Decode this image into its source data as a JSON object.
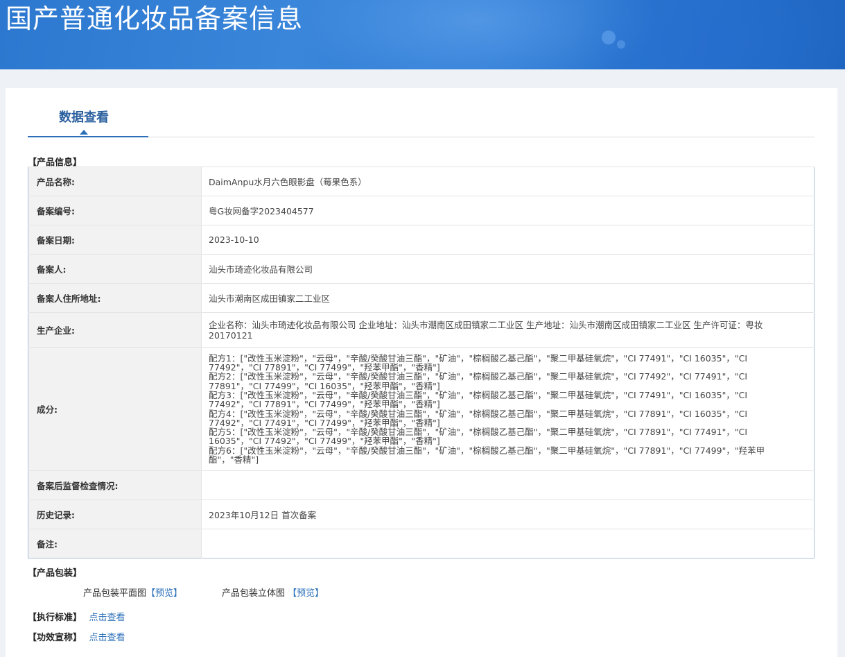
{
  "header": {
    "title": "国产普通化妆品备案信息"
  },
  "tabs": [
    {
      "label": "数据查看"
    }
  ],
  "product_info": {
    "section_title": "【产品信息】",
    "rows": [
      {
        "label": "产品名称:",
        "value": "DaimAnpu水月六色眼影盘（莓果色系）"
      },
      {
        "label": "备案编号:",
        "value": "粤G妆网备字2023404577"
      },
      {
        "label": "备案日期:",
        "value": "2023-10-10"
      },
      {
        "label": "备案人:",
        "value": "汕头市琦迹化妆品有限公司"
      },
      {
        "label": "备案人住所地址:",
        "value": "汕头市潮南区成田镇家二工业区"
      },
      {
        "label": "生产企业:",
        "value": "企业名称：汕头市琦迹化妆品有限公司 企业地址：汕头市潮南区成田镇家二工业区 生产地址：汕头市潮南区成田镇家二工业区 生产许可证：粤妆20170121"
      },
      {
        "label": "成分:",
        "formulas": [
          "配方1：[\"改性玉米淀粉\"，\"云母\"，\"辛酸/癸酸甘油三酯\"，\"矿油\"，\"棕榈酸乙基己酯\"，\"聚二甲基硅氧烷\"，\"CI 77491\"，\"CI 16035\"，\"CI 77492\"，\"CI 77891\"，\"CI 77499\"，\"羟苯甲酯\"，\"香精\"]",
          "配方2：[\"改性玉米淀粉\"，\"云母\"，\"辛酸/癸酸甘油三酯\"，\"矿油\"，\"棕榈酸乙基己酯\"，\"聚二甲基硅氧烷\"，\"CI 77492\"，\"CI 77491\"，\"CI 77891\"，\"CI 77499\"，\"CI 16035\"，\"羟苯甲酯\"，\"香精\"]",
          "配方3：[\"改性玉米淀粉\"，\"云母\"，\"辛酸/癸酸甘油三酯\"，\"矿油\"，\"棕榈酸乙基己酯\"，\"聚二甲基硅氧烷\"，\"CI 77491\"，\"CI 16035\"，\"CI 77492\"，\"CI 77891\"，\"CI 77499\"，\"羟苯甲酯\"，\"香精\"]",
          "配方4：[\"改性玉米淀粉\"，\"云母\"，\"辛酸/癸酸甘油三酯\"，\"矿油\"，\"棕榈酸乙基己酯\"，\"聚二甲基硅氧烷\"，\"CI 77891\"，\"CI 16035\"，\"CI 77492\"，\"CI 77491\"，\"CI 77499\"，\"羟苯甲酯\"，\"香精\"]",
          "配方5：[\"改性玉米淀粉\"，\"云母\"，\"辛酸/癸酸甘油三酯\"，\"矿油\"，\"棕榈酸乙基己酯\"，\"聚二甲基硅氧烷\"，\"CI 77891\"，\"CI 77491\"，\"CI 16035\"，\"CI 77492\"，\"CI 77499\"，\"羟苯甲酯\"，\"香精\"]",
          "配方6：[\"改性玉米淀粉\"，\"云母\"，\"辛酸/癸酸甘油三酯\"，\"矿油\"，\"棕榈酸乙基己酯\"，\"聚二甲基硅氧烷\"，\"CI 77891\"，\"CI 77499\"，\"羟苯甲酯\"，\"香精\"]"
        ]
      },
      {
        "label": "备案后监督检查情况:",
        "value": ""
      },
      {
        "label": "历史记录:",
        "value": "2023年10月12日 首次备案"
      },
      {
        "label": "备注:",
        "value": ""
      }
    ]
  },
  "packaging": {
    "section_title": "【产品包装】",
    "flat_label": "产品包装平面图",
    "flat_link": "【预览】",
    "stereo_label": "产品包装立体图",
    "stereo_link": "【预览】"
  },
  "standard": {
    "section_title": "【执行标准】",
    "link": "点击查看"
  },
  "efficacy": {
    "section_title": "【功效宣称】",
    "link": "点击查看"
  },
  "colors": {
    "accent": "#2a6fb8",
    "banner": "#2f7cd6",
    "table_border": "#a9bfdc"
  }
}
